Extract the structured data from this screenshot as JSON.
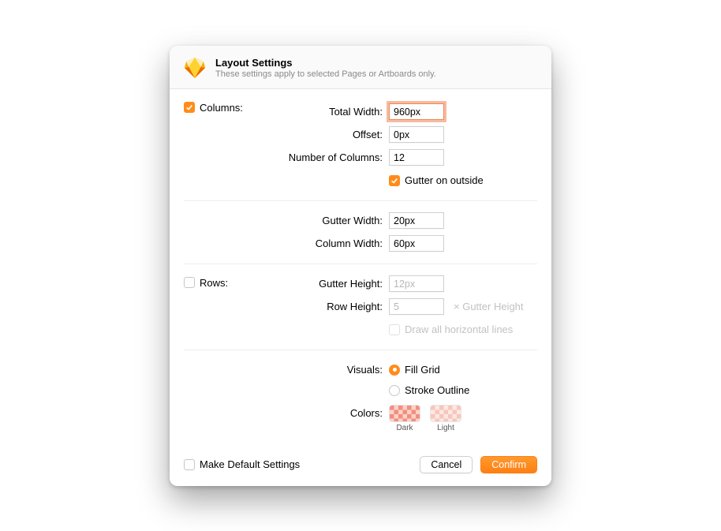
{
  "header": {
    "title": "Layout Settings",
    "subtitle": "These settings apply to selected Pages or Artboards only."
  },
  "columns": {
    "section_label": "Columns:",
    "total_width_label": "Total Width:",
    "total_width_value": "960px",
    "offset_label": "Offset:",
    "offset_value": "0px",
    "num_columns_label": "Number of Columns:",
    "num_columns_value": "12",
    "gutter_outside_label": "Gutter on outside",
    "gutter_width_label": "Gutter Width:",
    "gutter_width_value": "20px",
    "column_width_label": "Column Width:",
    "column_width_value": "60px"
  },
  "rows": {
    "section_label": "Rows:",
    "gutter_height_label": "Gutter Height:",
    "gutter_height_value": "12px",
    "row_height_label": "Row Height:",
    "row_height_value": "5",
    "row_height_suffix": "× Gutter Height",
    "draw_lines_label": "Draw all horizontal lines"
  },
  "visuals": {
    "label": "Visuals:",
    "fill_label": "Fill Grid",
    "stroke_label": "Stroke Outline",
    "colors_label": "Colors:",
    "dark_label": "Dark",
    "light_label": "Light",
    "dark_hex": "#f38e7c",
    "light_hex": "#f7c6bc"
  },
  "footer": {
    "make_default_label": "Make Default Settings",
    "cancel_label": "Cancel",
    "confirm_label": "Confirm"
  }
}
